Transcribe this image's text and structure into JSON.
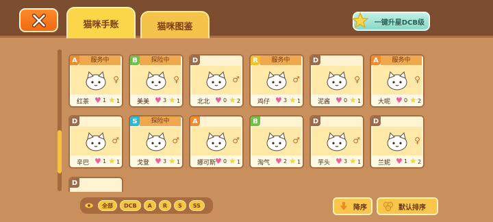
{
  "header": {
    "tabs": [
      {
        "label": "猫咪手账",
        "active": true
      },
      {
        "label": "猫咪图鉴",
        "active": false
      }
    ],
    "upgrade_label": "一键升星DCB级"
  },
  "colors": {
    "grade_A": "#f08a2c",
    "grade_B": "#6cc24a",
    "grade_D": "#9b6a4a",
    "grade_R": "#f3c226",
    "grade_S": "#2bb7d8",
    "heart": "#ee5f9b",
    "star": "#f5d43a"
  },
  "cards": [
    {
      "grade": "A",
      "status": "服务中",
      "name": "红茶",
      "hearts": "1",
      "stars": "1",
      "sex": "♀"
    },
    {
      "grade": "B",
      "status": "探险中",
      "name": "美美",
      "hearts": "3",
      "stars": "1",
      "sex": "♀"
    },
    {
      "grade": "D",
      "status": "",
      "name": "北北",
      "hearts": "0",
      "stars": "2",
      "sex": "♂"
    },
    {
      "grade": "R",
      "status": "服务中",
      "name": "鸡仔",
      "hearts": "3",
      "stars": "1",
      "sex": "♂"
    },
    {
      "grade": "D",
      "status": "",
      "name": "泥酱",
      "hearts": "0",
      "stars": "1",
      "sex": "♀"
    },
    {
      "grade": "A",
      "status": "服务中",
      "name": "大呢",
      "hearts": "0",
      "stars": "2",
      "sex": "♀"
    },
    {
      "grade": "D",
      "status": "",
      "name": "辛巴",
      "hearts": "1",
      "stars": "1",
      "sex": "♂"
    },
    {
      "grade": "S",
      "status": "探险中",
      "name": "戈登",
      "hearts": "3",
      "stars": "1",
      "sex": "♂"
    },
    {
      "grade": "A",
      "status": "",
      "name": "娜可斯",
      "hearts": "0",
      "stars": "1",
      "sex": "♂"
    },
    {
      "grade": "B",
      "status": "",
      "name": "淘气",
      "hearts": "2",
      "stars": "1",
      "sex": "♂"
    },
    {
      "grade": "D",
      "status": "",
      "name": "芋头",
      "hearts": "3",
      "stars": "1",
      "sex": "♂"
    },
    {
      "grade": "D",
      "status": "",
      "name": "兰妮",
      "hearts": "1",
      "stars": "2",
      "sex": "♀"
    }
  ],
  "partial_card_grade": "D",
  "filters": [
    "全部",
    "DCB",
    "A",
    "R",
    "S",
    "SS"
  ],
  "sort": {
    "descending_label": "降序",
    "default_label": "默认排序"
  }
}
